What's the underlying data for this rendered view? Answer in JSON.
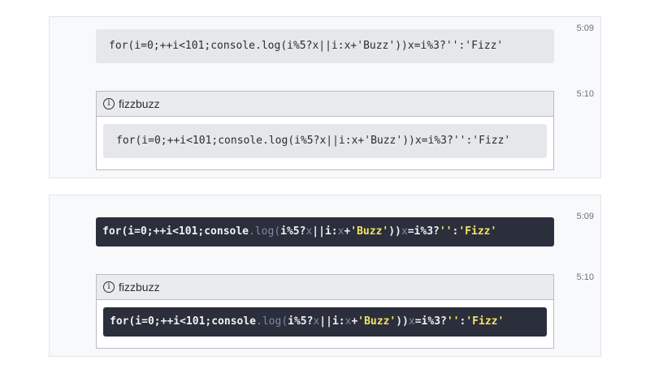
{
  "messages": [
    {
      "theme": "light",
      "first": {
        "time": "5:09",
        "code": "for(i=0;++i<101;console.log(i%5?x||i:x+'Buzz'))x=i%3?'':'Fizz'"
      },
      "second": {
        "time": "5:10",
        "attachment_title": "fizzbuzz",
        "code": "for(i=0;++i<101;console.log(i%5?x||i:x+'Buzz'))x=i%3?'':'Fizz'"
      }
    },
    {
      "theme": "dark",
      "first": {
        "time": "5:09"
      },
      "second": {
        "time": "5:10",
        "attachment_title": "fizzbuzz"
      },
      "tokens": {
        "t1": "for(i=0;++i<101;console",
        "t2": ".log(",
        "t3": "i%5?",
        "t4": "x",
        "t5": "||i:",
        "t6": "x",
        "t7": "+",
        "t8": "'Buzz'",
        "t9": "))",
        "t10": "x",
        "t11": "=i%3?",
        "t12": "''",
        "t13": ":",
        "t14": "'Fizz'"
      }
    }
  ],
  "colors": {
    "code_dark_bg": "#2b2e3b",
    "string": "#f2e36b",
    "dim": "#7f8aa8"
  },
  "icons": {
    "attachment": "info-icon"
  }
}
